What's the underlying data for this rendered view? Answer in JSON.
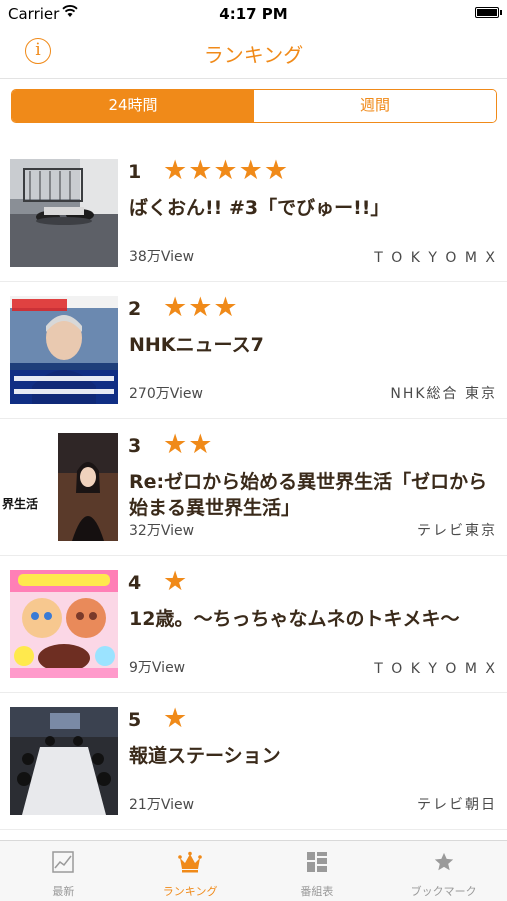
{
  "status_bar": {
    "carrier": "Carrier",
    "time": "4:17 PM"
  },
  "nav": {
    "title": "ランキング",
    "info_icon": "info-icon",
    "info_glyph": "i"
  },
  "segments": [
    {
      "label": "24時間",
      "selected": true
    },
    {
      "label": "週間",
      "selected": false
    }
  ],
  "rankings": [
    {
      "rank": "1",
      "stars": "★★★★★",
      "star_count": 5,
      "title": "ばくおん!! #3「でびゅー!!」",
      "views": "38万View",
      "channel": "T O K Y O M X"
    },
    {
      "rank": "2",
      "stars": "★★★",
      "star_count": 3,
      "title": "NHKニュース7",
      "views": "270万View",
      "channel": "NHK総合 東京"
    },
    {
      "rank": "3",
      "stars": "★★",
      "star_count": 2,
      "title": "Re:ゼロから始める異世界生活「ゼロから始まる異世界生活」",
      "views": "32万View",
      "channel": "テレビ東京"
    },
    {
      "rank": "4",
      "stars": "★",
      "star_count": 1,
      "title": "12歳。〜ちっちゃなムネのトキメキ〜",
      "views": "9万View",
      "channel": "T O K Y O M X"
    },
    {
      "rank": "5",
      "stars": "★",
      "star_count": 1,
      "title": "報道ステーション",
      "views": "21万View",
      "channel": "テレビ朝日"
    }
  ],
  "thumb_text": {
    "r3": "界生活"
  },
  "tabs": [
    {
      "label": "最新",
      "icon": "chart-icon",
      "active": false
    },
    {
      "label": "ランキング",
      "icon": "crown-icon",
      "active": true
    },
    {
      "label": "番組表",
      "icon": "grid-icon",
      "active": false
    },
    {
      "label": "ブックマーク",
      "icon": "star-icon",
      "active": false
    }
  ],
  "colors": {
    "accent": "#f08a19",
    "text": "#3a2a1a",
    "tab_inactive": "#9a9a9a"
  }
}
